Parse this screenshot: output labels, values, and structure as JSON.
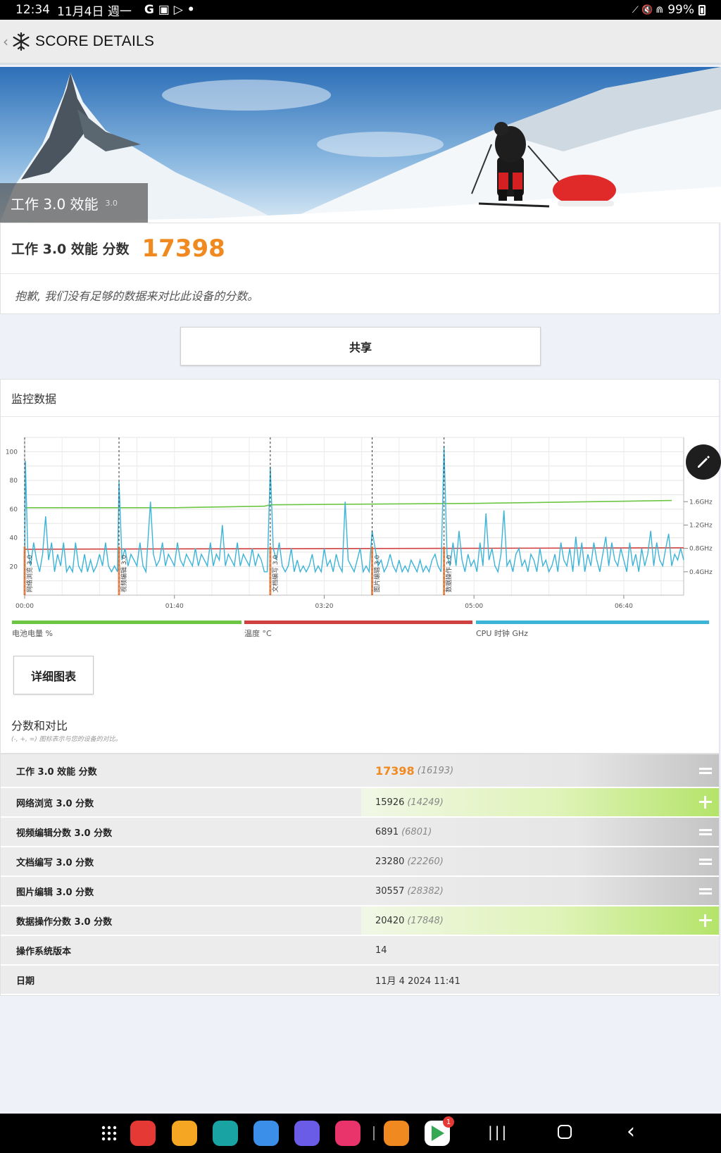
{
  "status_bar": {
    "time": "12:34",
    "date": "11月4日 週一",
    "app_icons": "G ▣ ▷ •",
    "system_icons": "⟋ 🔇 ⋒",
    "battery": "99%"
  },
  "app_bar": {
    "title": "SCORE DETAILS"
  },
  "hero": {
    "caption": "工作 3.0 效能",
    "version": "3.0"
  },
  "score": {
    "label": "工作 3.0 效能 分数",
    "value": "17398",
    "note": "抱歉, 我们没有足够的数据来对比此设备的分数。"
  },
  "share_label": "共享",
  "monitor": {
    "title": "监控数据",
    "detail_button": "详细图表",
    "compare_title": "分数和对比",
    "compare_note": "(-, +, =) 图标表示与您的设备的对比。"
  },
  "chart_data": {
    "type": "line",
    "x_ticks": [
      "00:00",
      "01:40",
      "03:20",
      "05:00",
      "06:40"
    ],
    "x_tick_seconds": [
      0,
      100,
      200,
      300,
      400
    ],
    "x_range_seconds": [
      0,
      440
    ],
    "y_left_ticks": [
      20,
      40,
      60,
      80,
      100
    ],
    "y_left_range": [
      0,
      110
    ],
    "y_right_ticks": [
      "0.4GHz",
      "0.8GHz",
      "1.2GHz",
      "1.6GHz"
    ],
    "y_right_values": [
      0.4,
      0.8,
      1.2,
      1.6
    ],
    "y_right_range": [
      0,
      2.7
    ],
    "markers": [
      {
        "label": "网络浏览 3.0",
        "x": 0
      },
      {
        "label": "视频编辑 3.0",
        "x": 63
      },
      {
        "label": "文档编写 3.0",
        "x": 164
      },
      {
        "label": "图片编辑 3.0",
        "x": 232
      },
      {
        "label": "数据操作 3.0",
        "x": 280
      }
    ],
    "series": [
      {
        "name": "电池电量 %",
        "color": "#6cc644",
        "axis": "left",
        "points": [
          [
            0,
            61
          ],
          [
            100,
            61
          ],
          [
            160,
            62
          ],
          [
            164,
            63
          ],
          [
            300,
            64
          ],
          [
            432,
            66
          ]
        ]
      },
      {
        "name": "温度 °C",
        "color": "#d04040",
        "axis": "left",
        "points": [
          [
            0,
            32
          ],
          [
            440,
            33
          ]
        ]
      },
      {
        "name": "CPU 时钟 GHz",
        "color": "#3cb4d8",
        "axis": "right",
        "points": [
          [
            0,
            0.3
          ],
          [
            0.5,
            2.3
          ],
          [
            2,
            0.8
          ],
          [
            4,
            0.5
          ],
          [
            6,
            0.9
          ],
          [
            8,
            0.6
          ],
          [
            10,
            0.4
          ],
          [
            12,
            0.7
          ],
          [
            14,
            1.35
          ],
          [
            16,
            0.6
          ],
          [
            18,
            0.9
          ],
          [
            20,
            0.4
          ],
          [
            22,
            0.7
          ],
          [
            24,
            0.5
          ],
          [
            26,
            0.9
          ],
          [
            28,
            0.4
          ],
          [
            30,
            0.5
          ],
          [
            32,
            0.4
          ],
          [
            34,
            0.9
          ],
          [
            36,
            0.5
          ],
          [
            38,
            0.4
          ],
          [
            40,
            0.7
          ],
          [
            42,
            0.4
          ],
          [
            44,
            0.6
          ],
          [
            46,
            0.4
          ],
          [
            48,
            0.5
          ],
          [
            50,
            0.7
          ],
          [
            52,
            0.5
          ],
          [
            54,
            0.9
          ],
          [
            56,
            0.5
          ],
          [
            58,
            0.4
          ],
          [
            60,
            0.5
          ],
          [
            62,
            0.4
          ],
          [
            63,
            1.95
          ],
          [
            65,
            0.6
          ],
          [
            67,
            0.8
          ],
          [
            69,
            0.5
          ],
          [
            71,
            0.7
          ],
          [
            73,
            0.6
          ],
          [
            75,
            0.5
          ],
          [
            77,
            0.9
          ],
          [
            79,
            0.5
          ],
          [
            81,
            0.4
          ],
          [
            84,
            1.6
          ],
          [
            86,
            0.7
          ],
          [
            88,
            0.5
          ],
          [
            90,
            0.6
          ],
          [
            92,
            0.9
          ],
          [
            94,
            0.5
          ],
          [
            96,
            0.7
          ],
          [
            98,
            0.6
          ],
          [
            100,
            0.5
          ],
          [
            102,
            0.9
          ],
          [
            104,
            0.6
          ],
          [
            106,
            0.5
          ],
          [
            108,
            0.7
          ],
          [
            110,
            0.6
          ],
          [
            112,
            0.5
          ],
          [
            114,
            0.8
          ],
          [
            116,
            0.5
          ],
          [
            118,
            0.7
          ],
          [
            120,
            0.6
          ],
          [
            122,
            0.5
          ],
          [
            124,
            0.9
          ],
          [
            126,
            0.5
          ],
          [
            128,
            0.7
          ],
          [
            130,
            0.6
          ],
          [
            132,
            1.2
          ],
          [
            134,
            0.5
          ],
          [
            136,
            0.7
          ],
          [
            138,
            0.6
          ],
          [
            140,
            0.5
          ],
          [
            142,
            0.9
          ],
          [
            144,
            0.5
          ],
          [
            146,
            0.7
          ],
          [
            148,
            0.6
          ],
          [
            150,
            0.5
          ],
          [
            152,
            0.8
          ],
          [
            154,
            0.5
          ],
          [
            156,
            0.7
          ],
          [
            158,
            0.6
          ],
          [
            160,
            0.4
          ],
          [
            162,
            0.4
          ],
          [
            164,
            2.2
          ],
          [
            166,
            0.8
          ],
          [
            168,
            0.6
          ],
          [
            170,
            0.9
          ],
          [
            172,
            0.5
          ],
          [
            174,
            0.4
          ],
          [
            176,
            0.5
          ],
          [
            178,
            0.8
          ],
          [
            180,
            0.4
          ],
          [
            182,
            0.6
          ],
          [
            184,
            0.4
          ],
          [
            186,
            0.5
          ],
          [
            188,
            0.4
          ],
          [
            190,
            0.5
          ],
          [
            192,
            0.7
          ],
          [
            194,
            0.4
          ],
          [
            196,
            0.5
          ],
          [
            198,
            0.4
          ],
          [
            200,
            0.8
          ],
          [
            202,
            0.5
          ],
          [
            204,
            0.6
          ],
          [
            206,
            0.4
          ],
          [
            208,
            0.7
          ],
          [
            210,
            0.5
          ],
          [
            212,
            0.4
          ],
          [
            214,
            1.6
          ],
          [
            216,
            0.6
          ],
          [
            218,
            0.5
          ],
          [
            220,
            0.4
          ],
          [
            222,
            0.6
          ],
          [
            224,
            0.8
          ],
          [
            226,
            0.4
          ],
          [
            228,
            0.5
          ],
          [
            230,
            0.4
          ],
          [
            232,
            1.1
          ],
          [
            234,
            0.8
          ],
          [
            236,
            0.5
          ],
          [
            238,
            0.6
          ],
          [
            240,
            0.4
          ],
          [
            242,
            0.5
          ],
          [
            244,
            0.7
          ],
          [
            246,
            0.5
          ],
          [
            248,
            0.4
          ],
          [
            250,
            0.6
          ],
          [
            252,
            0.4
          ],
          [
            254,
            0.5
          ],
          [
            256,
            0.4
          ],
          [
            258,
            0.6
          ],
          [
            260,
            0.5
          ],
          [
            262,
            0.4
          ],
          [
            264,
            0.6
          ],
          [
            266,
            0.4
          ],
          [
            268,
            0.5
          ],
          [
            270,
            0.4
          ],
          [
            272,
            0.6
          ],
          [
            274,
            0.7
          ],
          [
            276,
            0.5
          ],
          [
            278,
            0.4
          ],
          [
            280,
            2.55
          ],
          [
            282,
            0.7
          ],
          [
            284,
            0.5
          ],
          [
            286,
            0.9
          ],
          [
            288,
            0.5
          ],
          [
            290,
            1.1
          ],
          [
            292,
            0.6
          ],
          [
            294,
            0.4
          ],
          [
            296,
            0.7
          ],
          [
            298,
            0.5
          ],
          [
            300,
            0.6
          ],
          [
            302,
            0.4
          ],
          [
            304,
            0.9
          ],
          [
            306,
            0.5
          ],
          [
            308,
            1.4
          ],
          [
            310,
            0.6
          ],
          [
            312,
            0.8
          ],
          [
            314,
            0.5
          ],
          [
            316,
            0.4
          ],
          [
            318,
            0.7
          ],
          [
            320,
            1.45
          ],
          [
            322,
            0.5
          ],
          [
            324,
            0.6
          ],
          [
            326,
            0.4
          ],
          [
            328,
            0.7
          ],
          [
            330,
            0.8
          ],
          [
            332,
            0.5
          ],
          [
            334,
            0.6
          ],
          [
            336,
            0.4
          ],
          [
            338,
            0.7
          ],
          [
            340,
            0.6
          ],
          [
            342,
            0.4
          ],
          [
            344,
            0.8
          ],
          [
            346,
            0.5
          ],
          [
            348,
            0.6
          ],
          [
            350,
            0.4
          ],
          [
            352,
            0.5
          ],
          [
            354,
            0.7
          ],
          [
            356,
            0.4
          ],
          [
            358,
            0.9
          ],
          [
            360,
            0.6
          ],
          [
            362,
            0.5
          ],
          [
            364,
            0.8
          ],
          [
            366,
            0.4
          ],
          [
            368,
            1.0
          ],
          [
            370,
            0.5
          ],
          [
            372,
            0.9
          ],
          [
            374,
            0.4
          ],
          [
            376,
            0.7
          ],
          [
            378,
            0.5
          ],
          [
            380,
            0.9
          ],
          [
            382,
            0.6
          ],
          [
            384,
            0.4
          ],
          [
            386,
            0.7
          ],
          [
            388,
            1.0
          ],
          [
            390,
            0.5
          ],
          [
            392,
            0.9
          ],
          [
            394,
            0.6
          ],
          [
            396,
            0.5
          ],
          [
            398,
            0.8
          ],
          [
            400,
            0.6
          ],
          [
            402,
            0.4
          ],
          [
            404,
            0.9
          ],
          [
            406,
            0.5
          ],
          [
            408,
            0.7
          ],
          [
            410,
            0.4
          ],
          [
            412,
            0.8
          ],
          [
            414,
            0.5
          ],
          [
            416,
            0.7
          ],
          [
            418,
            1.1
          ],
          [
            420,
            0.5
          ],
          [
            422,
            0.9
          ],
          [
            424,
            0.6
          ],
          [
            426,
            0.5
          ],
          [
            428,
            0.8
          ],
          [
            430,
            1.05
          ],
          [
            432,
            0.5
          ],
          [
            434,
            0.7
          ],
          [
            436,
            0.6
          ],
          [
            438,
            0.8
          ],
          [
            440,
            0.6
          ]
        ]
      }
    ]
  },
  "score_table": [
    {
      "label": "工作 3.0 效能 分数",
      "value": "17398",
      "avg": "(16193)",
      "compare": "=",
      "style": "grey",
      "big": true
    },
    {
      "label": "网络浏览 3.0 分数",
      "value": "15926",
      "avg": "(14249)",
      "compare": "+",
      "style": "green"
    },
    {
      "label": "视频编辑分数 3.0 分数",
      "value": "6891",
      "avg": "(6801)",
      "compare": "=",
      "style": "grey"
    },
    {
      "label": "文档编写 3.0 分数",
      "value": "23280",
      "avg": "(22260)",
      "compare": "=",
      "style": "grey"
    },
    {
      "label": "图片编辑 3.0 分数",
      "value": "30557",
      "avg": "(28382)",
      "compare": "=",
      "style": "grey"
    },
    {
      "label": "数据操作分数 3.0 分数",
      "value": "20420",
      "avg": "(17848)",
      "compare": "+",
      "style": "green"
    },
    {
      "label": "操作系统版本",
      "value": "14",
      "avg": "",
      "compare": "",
      "style": "plain"
    },
    {
      "label": "日期",
      "value": "11月 4 2024 11:41",
      "avg": "",
      "compare": "",
      "style": "plain"
    }
  ],
  "nav_bar": {
    "apps": [
      {
        "name": "app-drawer-icon",
        "color": "#000000"
      },
      {
        "name": "notes-app-icon",
        "color": "#e53935"
      },
      {
        "name": "files-app-icon",
        "color": "#f5a623"
      },
      {
        "name": "calendar-app-icon",
        "color": "#1aa3a3"
      },
      {
        "name": "messages-app-icon",
        "color": "#3b8fe8"
      },
      {
        "name": "internet-app-icon",
        "color": "#6b5ce7"
      },
      {
        "name": "camera-app-icon",
        "color": "#e8336b"
      },
      {
        "name": "3dmark-app-icon",
        "color": "#f08a20"
      },
      {
        "name": "play-store-icon",
        "color": "#34a853"
      }
    ],
    "play_store_badge": "1"
  }
}
